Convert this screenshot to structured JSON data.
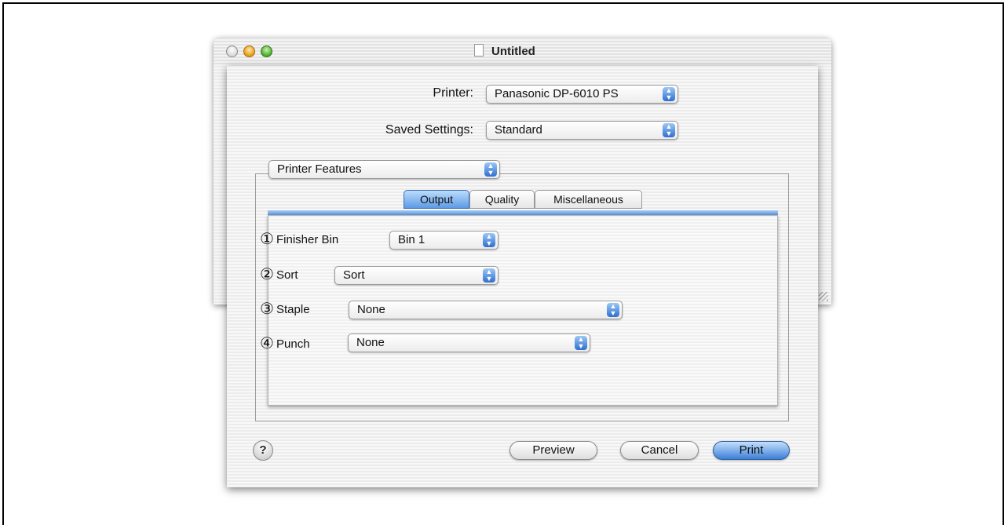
{
  "document_window": {
    "title": "Untitled"
  },
  "print_dialog": {
    "printer_label": "Printer:",
    "printer_value": "Panasonic DP-6010 PS",
    "saved_settings_label": "Saved Settings:",
    "saved_settings_value": "Standard",
    "panel_selector_value": "Printer Features",
    "tabs": [
      {
        "label": "Output",
        "active": true
      },
      {
        "label": "Quality",
        "active": false
      },
      {
        "label": "Miscellaneous",
        "active": false
      }
    ],
    "options": {
      "finisher_bin": {
        "marker": "①",
        "label": "Finisher Bin",
        "value": "Bin 1"
      },
      "sort": {
        "marker": "②",
        "label": "Sort",
        "value": "Sort"
      },
      "staple": {
        "marker": "③",
        "label": "Staple",
        "value": "None"
      },
      "punch": {
        "marker": "④",
        "label": "Punch",
        "value": "None"
      }
    },
    "buttons": {
      "help": "?",
      "preview": "Preview",
      "cancel": "Cancel",
      "print": "Print"
    }
  },
  "colors": {
    "accent_blue": "#3d7fd8",
    "tab_active": "#5d9ae6"
  },
  "icons": {
    "popup_arrow": "up-down-arrows-icon",
    "help": "question-mark-icon"
  }
}
